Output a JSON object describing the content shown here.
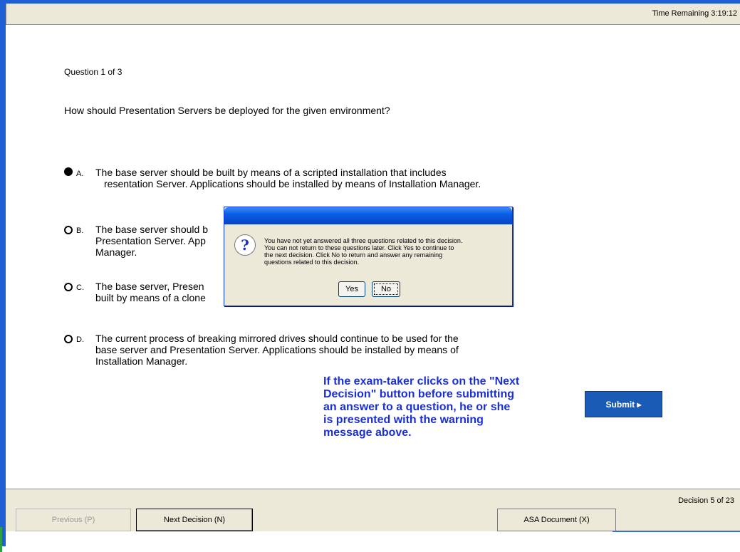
{
  "header": {
    "time_remaining": "Time Remaining 3:19:12"
  },
  "question": {
    "number": "Question 1 of 3",
    "text": "How should Presentation Servers be deployed for the given environment?"
  },
  "options": [
    {
      "letter": "A.",
      "selected": true,
      "lines": [
        "The base server should be built by means of a scripted installation that includes",
        "resentation Server. Applications should be installed by means of Installation Manager."
      ]
    },
    {
      "letter": "B.",
      "selected": false,
      "lines": [
        "The base server should b",
        "Presentation Server. App",
        "Manager."
      ]
    },
    {
      "letter": "C.",
      "selected": false,
      "lines": [
        "The base server, Presen",
        "built by means of a clone"
      ]
    },
    {
      "letter": "D.",
      "selected": false,
      "lines": [
        "The current process of breaking mirrored drives should continue to be used for the",
        "base server and Presentation Server. Applications should be installed by means of",
        "Installation Manager."
      ]
    }
  ],
  "dialog": {
    "message": [
      "You have not yet answered all three questions related to this decision.",
      "You can not return to these questions later. Click Yes to continue to",
      "the next decision.  Click No to return and answer any remaining",
      "questions related to this decision."
    ],
    "yes_label": "Yes",
    "no_label": "No",
    "icon": "question-icon"
  },
  "annotation": [
    "If the exam-taker clicks on the \"Next",
    "Decision\" button before submitting",
    "an answer to a question, he or she",
    "is presented with the warning",
    "message above."
  ],
  "submit_label": "Submit ▸",
  "footer": {
    "decision": "Decision 5 of 23",
    "previous_label": "Previous (P)",
    "next_label": "Next Decision (N)",
    "asa_label": "ASA Document (X)"
  },
  "colors": {
    "accent": "#1f5fd6",
    "note": "#1a2fd4",
    "submit": "#1a5bb5"
  }
}
